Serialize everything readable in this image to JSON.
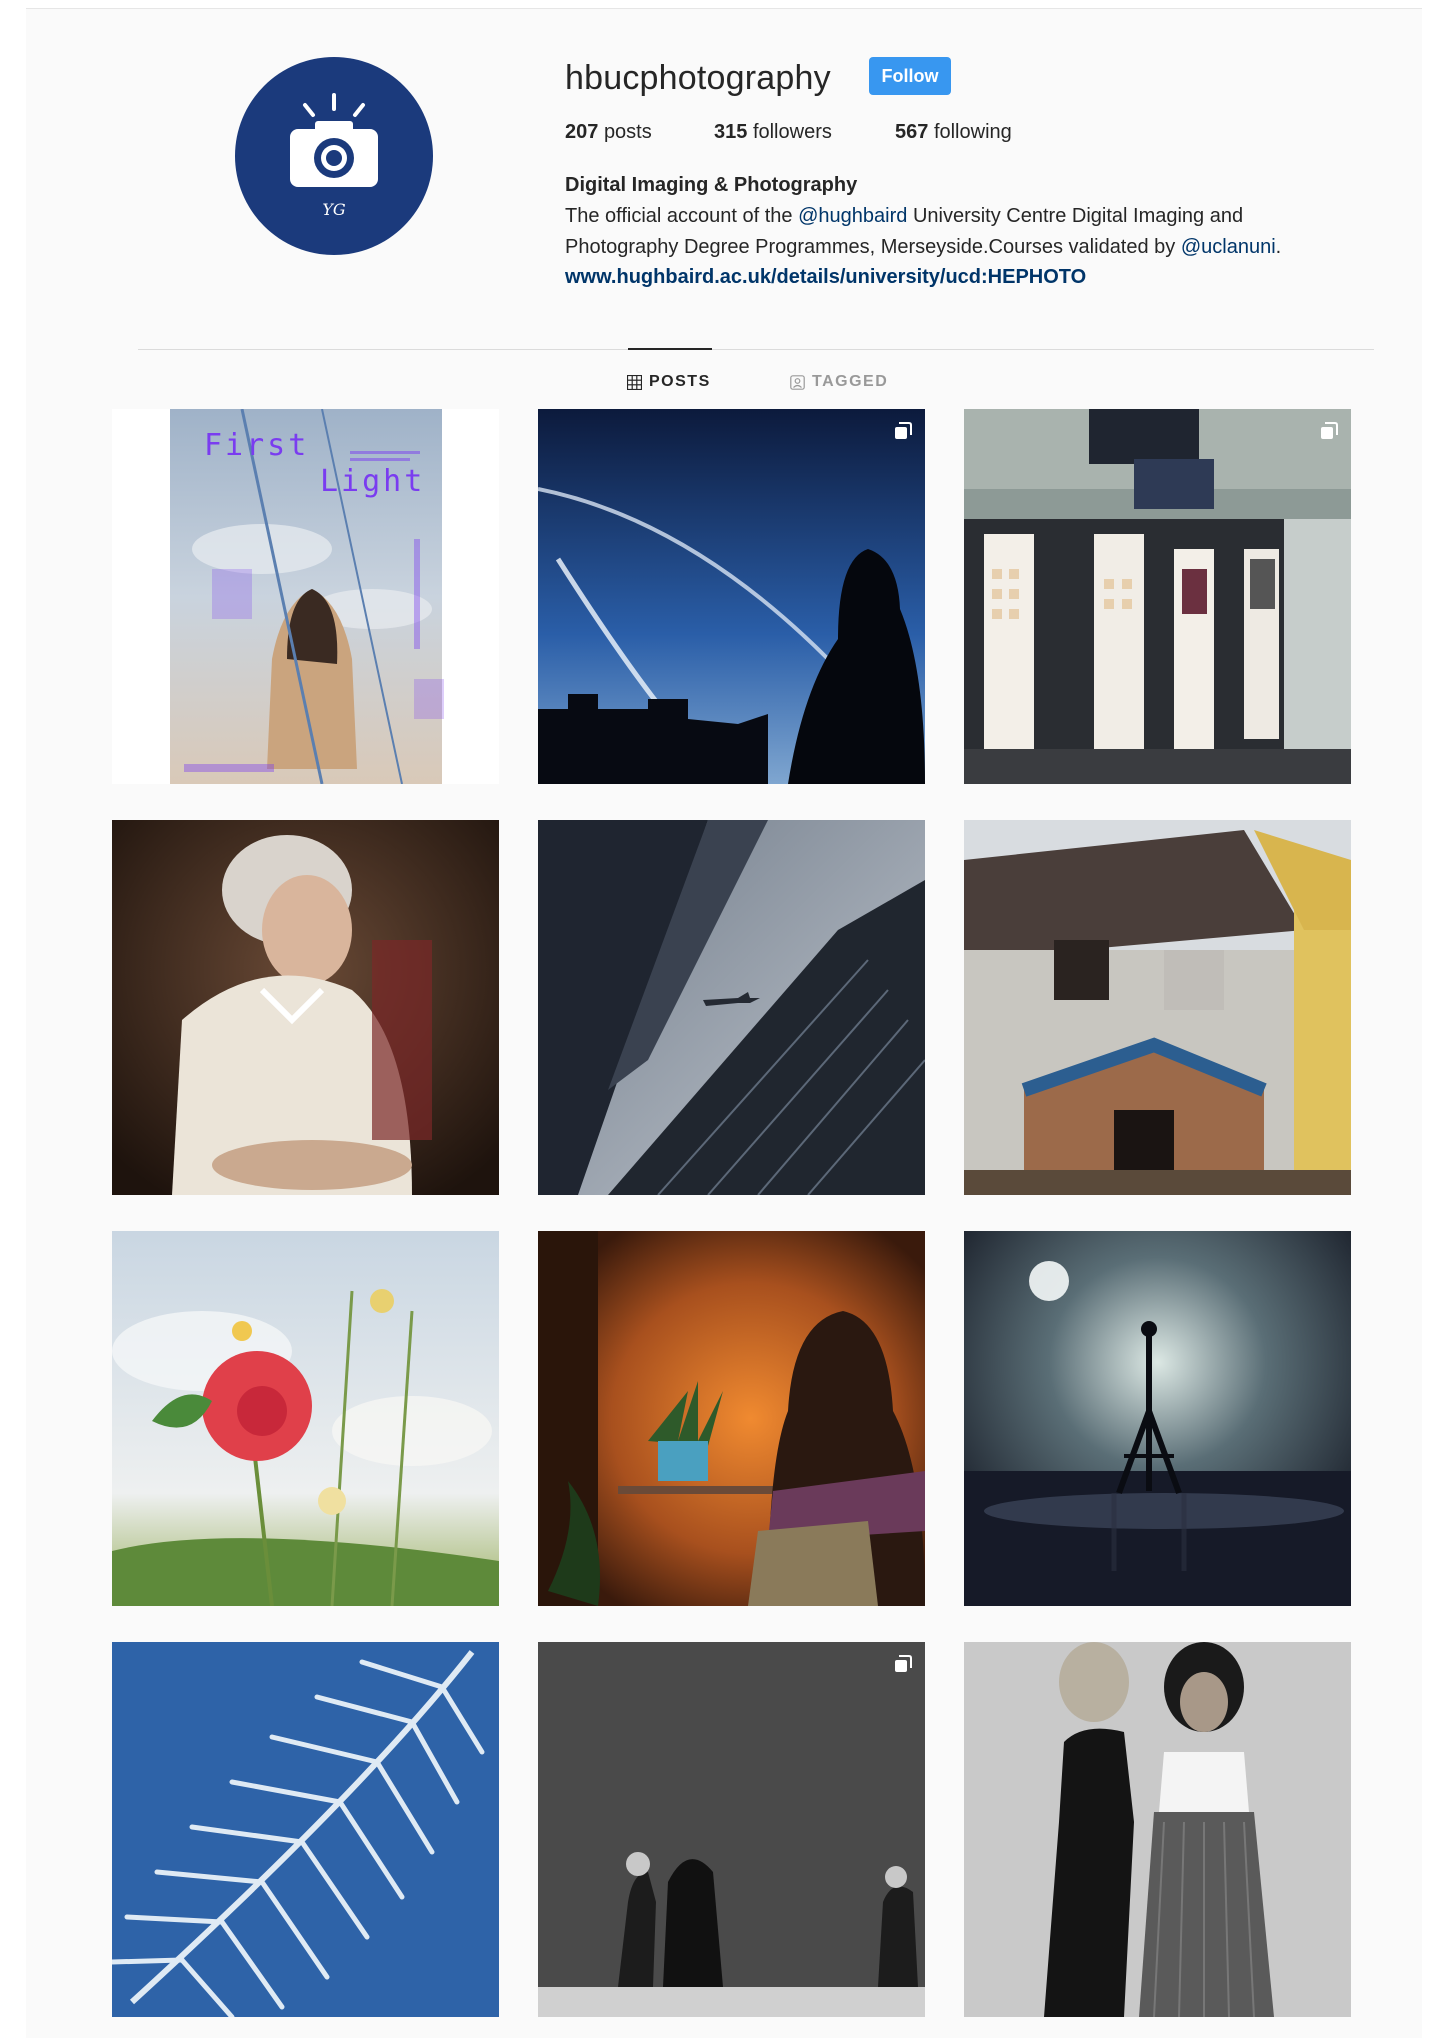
{
  "profile": {
    "username": "hbucphotography",
    "follow_label": "Follow",
    "stats": {
      "posts_count": "207",
      "posts_label": "posts",
      "followers_count": "315",
      "followers_label": "followers",
      "following_count": "567",
      "following_label": "following"
    },
    "full_name": "Digital Imaging & Photography",
    "bio": {
      "line1_prefix": "The official account of the ",
      "mention1": "@hughbaird",
      "line1_suffix": " University Centre Digital Imaging and",
      "line2_prefix": "Photography Degree Programmes, Merseyside.Courses validated by ",
      "mention2": "@uclanuni",
      "line2_suffix": "."
    },
    "website": "www.hughbaird.ac.uk/details/university/ucd:HEPHOTO",
    "avatar_mark": "YG"
  },
  "tabs": {
    "posts": "POSTS",
    "tagged": "TAGGED",
    "active": "posts"
  },
  "posts": [
    {
      "title_line1": "First",
      "title_line2": "Light",
      "multi": false
    },
    {
      "multi": true
    },
    {
      "multi": true
    },
    {
      "multi": false
    },
    {
      "multi": false
    },
    {
      "multi": false
    },
    {
      "multi": false
    },
    {
      "multi": false
    },
    {
      "multi": false
    },
    {
      "multi": false
    },
    {
      "multi": true
    },
    {
      "multi": false
    }
  ],
  "colors": {
    "accent": "#3897f0",
    "avatar_bg": "#1b3a7c",
    "link": "#003569"
  }
}
